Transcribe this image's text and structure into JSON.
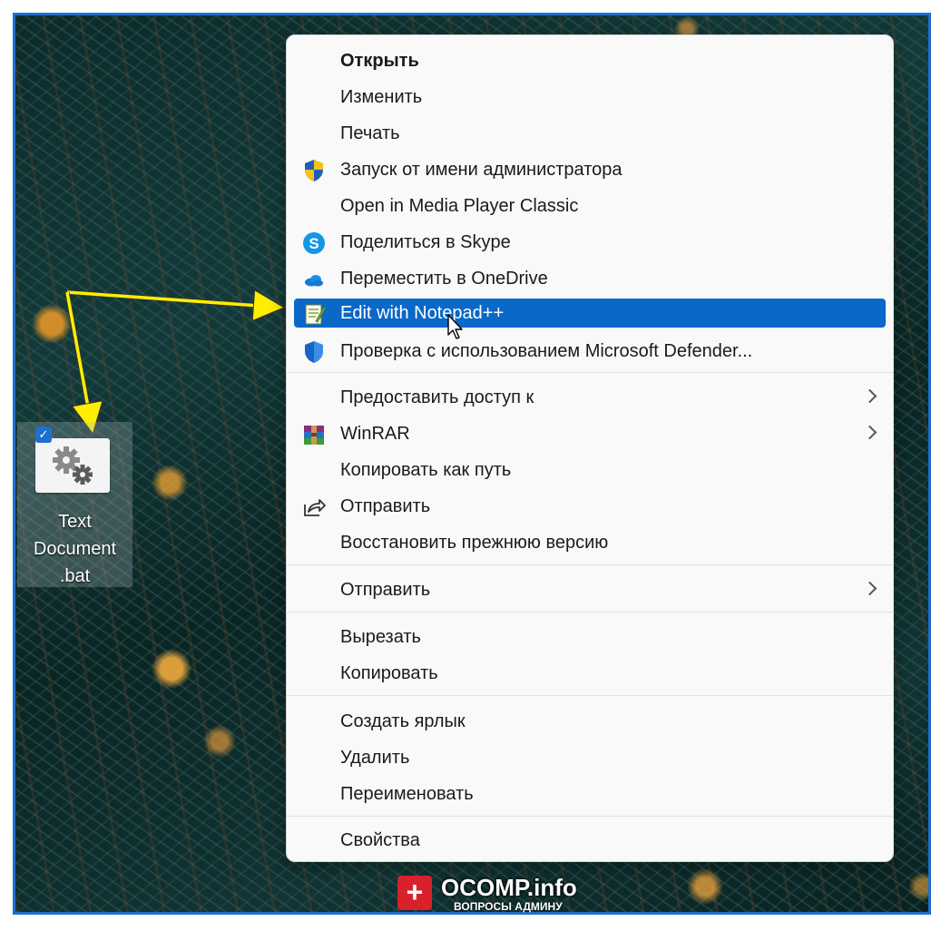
{
  "desktop_icon": {
    "label": "Text Document .bat",
    "selected": true
  },
  "context_menu": {
    "items": [
      {
        "label": "Открыть",
        "bold": true
      },
      {
        "label": "Изменить"
      },
      {
        "label": "Печать"
      },
      {
        "label": "Запуск от имени администратора",
        "icon": "uac-shield-icon"
      },
      {
        "label": "Open in Media Player Classic"
      },
      {
        "label": "Поделиться в Skype",
        "icon": "skype-icon"
      },
      {
        "label": "Переместить в OneDrive",
        "icon": "onedrive-cloud-icon"
      },
      {
        "label": "Edit with Notepad++",
        "icon": "notepadpp-icon",
        "highlighted": true
      },
      {
        "label": "Проверка с использованием Microsoft Defender...",
        "icon": "defender-shield-icon"
      },
      {
        "label": "Предоставить доступ к",
        "submenu": true
      },
      {
        "label": "WinRAR",
        "icon": "winrar-icon",
        "submenu": true
      },
      {
        "label": "Копировать как путь"
      },
      {
        "label": "Отправить",
        "icon": "share-icon"
      },
      {
        "label": "Восстановить прежнюю версию"
      },
      {
        "label": "Отправить",
        "submenu": true
      },
      {
        "label": "Вырезать"
      },
      {
        "label": "Копировать"
      },
      {
        "label": "Создать ярлык"
      },
      {
        "label": "Удалить"
      },
      {
        "label": "Переименовать"
      },
      {
        "label": "Свойства"
      }
    ]
  },
  "watermark": {
    "badge": "+",
    "brand": "OCOMP.info",
    "tagline": "ВОПРОСЫ АДМИНУ"
  },
  "colors": {
    "highlight": "#0a68c8",
    "arrow": "#ffee00",
    "frame": "#1f6fd1",
    "menu_bg": "#f9f9f9"
  }
}
